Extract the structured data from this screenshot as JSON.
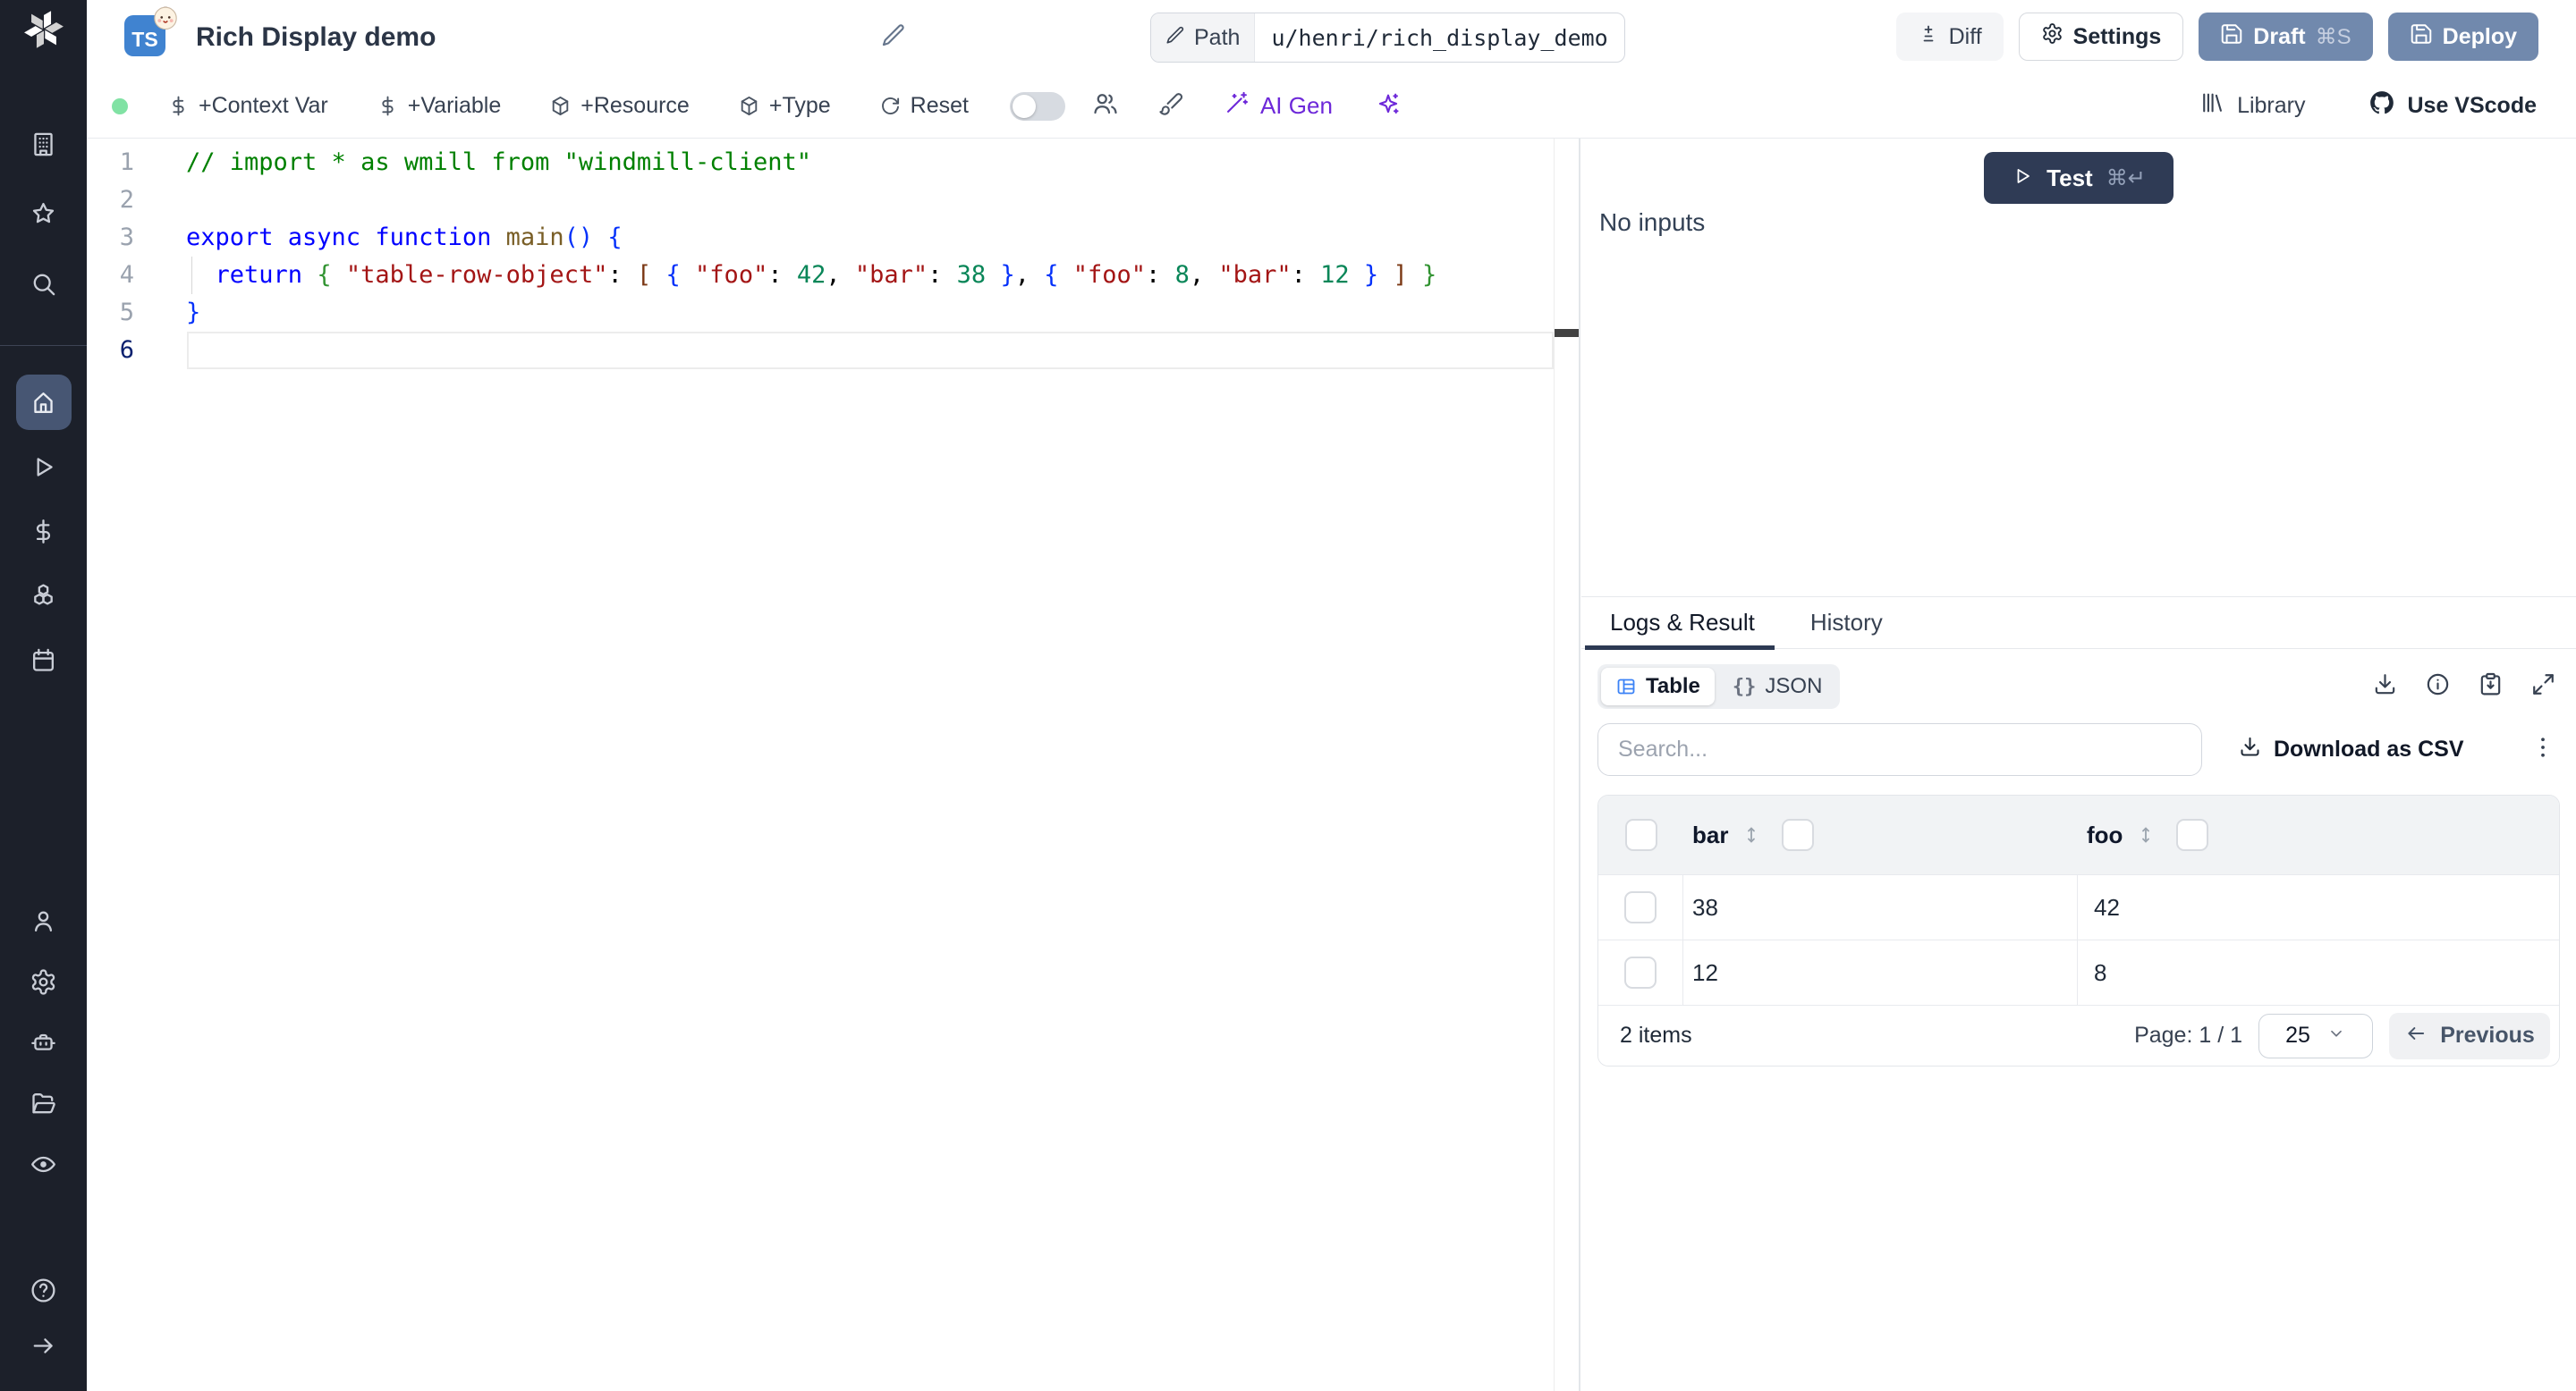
{
  "colors": {
    "sidebar_bg": "#1c202a",
    "active_item_bg": "#475673",
    "slate_button": "#7189ad",
    "primary_dark": "#2f3b55",
    "ai_purple": "#6d28d9",
    "table_icon_blue": "#3b82f6",
    "green_status_dot": "#81e2a4",
    "ts_badge_blue": "#4083d0"
  },
  "sidebar": {
    "groups": {
      "top": [
        {
          "id": "workspace",
          "icon": "building"
        },
        {
          "id": "favorites",
          "icon": "star"
        },
        {
          "id": "search",
          "icon": "search"
        }
      ],
      "main": [
        {
          "id": "home",
          "icon": "home",
          "active": true
        },
        {
          "id": "runs",
          "icon": "play"
        },
        {
          "id": "variables",
          "icon": "dollar"
        },
        {
          "id": "resources",
          "icon": "cubes"
        },
        {
          "id": "schedules",
          "icon": "calendar"
        }
      ],
      "lower": [
        {
          "id": "users",
          "icon": "user"
        },
        {
          "id": "settings",
          "icon": "gear"
        },
        {
          "id": "workers",
          "icon": "robot"
        },
        {
          "id": "folders",
          "icon": "folder"
        },
        {
          "id": "audit",
          "icon": "eye"
        }
      ],
      "footer": [
        {
          "id": "help",
          "icon": "help"
        },
        {
          "id": "expand",
          "icon": "arrow-right"
        }
      ]
    }
  },
  "header": {
    "language_badge": "TS",
    "title": "Rich Display demo",
    "path_label": "Path",
    "path_value": "u/henri/rich_display_demo",
    "diff_label": "Diff",
    "settings_label": "Settings",
    "draft_label": "Draft",
    "draft_shortcut": "⌘S",
    "deploy_label": "Deploy"
  },
  "toolbar": {
    "items": [
      {
        "label": "+Context Var",
        "icon": "dollar"
      },
      {
        "label": "+Variable",
        "icon": "dollar"
      },
      {
        "label": "+Resource",
        "icon": "box"
      },
      {
        "label": "+Type",
        "icon": "box"
      },
      {
        "label": "Reset",
        "icon": "reset"
      }
    ],
    "ai_gen_label": "AI Gen",
    "library_label": "Library",
    "vscode_label": "Use VScode"
  },
  "editor": {
    "line_numbers": [
      "1",
      "2",
      "3",
      "4",
      "5",
      "6"
    ],
    "active_line": 6,
    "token_colors": {
      "comment": "#008000",
      "keyword": "#0000ff",
      "string": "#a31515",
      "number": "#098658",
      "punct": "#000000",
      "plain": "#000000",
      "function": "#795e26",
      "brace1": "#0431fa",
      "brace2": "#319331",
      "brace3": "#7b3814"
    },
    "lines": [
      [
        {
          "t": "// import * as wmill from \"windmill-client\"",
          "c": "comment"
        }
      ],
      [],
      [
        {
          "t": "export async function ",
          "c": "keyword"
        },
        {
          "t": "main",
          "c": "function"
        },
        {
          "t": "() {",
          "c": "brace1"
        }
      ],
      [
        {
          "t": "  ",
          "c": "plain"
        },
        {
          "t": "return",
          "c": "keyword"
        },
        {
          "t": " ",
          "c": "plain"
        },
        {
          "t": "{",
          "c": "brace2"
        },
        {
          "t": " ",
          "c": "plain"
        },
        {
          "t": "\"table-row-object\"",
          "c": "string"
        },
        {
          "t": ": ",
          "c": "punct"
        },
        {
          "t": "[",
          "c": "brace3"
        },
        {
          "t": " ",
          "c": "plain"
        },
        {
          "t": "{",
          "c": "brace1"
        },
        {
          "t": " ",
          "c": "plain"
        },
        {
          "t": "\"foo\"",
          "c": "string"
        },
        {
          "t": ": ",
          "c": "punct"
        },
        {
          "t": "42",
          "c": "number"
        },
        {
          "t": ", ",
          "c": "punct"
        },
        {
          "t": "\"bar\"",
          "c": "string"
        },
        {
          "t": ": ",
          "c": "punct"
        },
        {
          "t": "38",
          "c": "number"
        },
        {
          "t": " ",
          "c": "plain"
        },
        {
          "t": "}",
          "c": "brace1"
        },
        {
          "t": ", ",
          "c": "punct"
        },
        {
          "t": "{",
          "c": "brace1"
        },
        {
          "t": " ",
          "c": "plain"
        },
        {
          "t": "\"foo\"",
          "c": "string"
        },
        {
          "t": ": ",
          "c": "punct"
        },
        {
          "t": "8",
          "c": "number"
        },
        {
          "t": ", ",
          "c": "punct"
        },
        {
          "t": "\"bar\"",
          "c": "string"
        },
        {
          "t": ": ",
          "c": "punct"
        },
        {
          "t": "12",
          "c": "number"
        },
        {
          "t": " ",
          "c": "plain"
        },
        {
          "t": "}",
          "c": "brace1"
        },
        {
          "t": " ",
          "c": "plain"
        },
        {
          "t": "]",
          "c": "brace3"
        },
        {
          "t": " ",
          "c": "plain"
        },
        {
          "t": "}",
          "c": "brace2"
        }
      ],
      [
        {
          "t": "}",
          "c": "brace1"
        }
      ],
      []
    ]
  },
  "run_panel": {
    "test_label": "Test",
    "test_shortcut": "⌘↵",
    "no_inputs_label": "No inputs",
    "tabs": [
      {
        "label": "Logs & Result",
        "active": true
      },
      {
        "label": "History",
        "active": false
      }
    ],
    "view_modes": [
      {
        "label": "Table",
        "icon": "table",
        "active": true
      },
      {
        "label": "JSON",
        "icon": "braces",
        "active": false
      }
    ],
    "search_placeholder": "Search...",
    "download_csv_label": "Download as CSV",
    "table": {
      "columns": [
        "bar",
        "foo"
      ],
      "rows": [
        [
          "38",
          "42"
        ],
        [
          "12",
          "8"
        ]
      ],
      "items_count_label": "2 items",
      "page_label": "Page: 1 / 1",
      "page_size": "25",
      "previous_label": "Previous"
    }
  }
}
